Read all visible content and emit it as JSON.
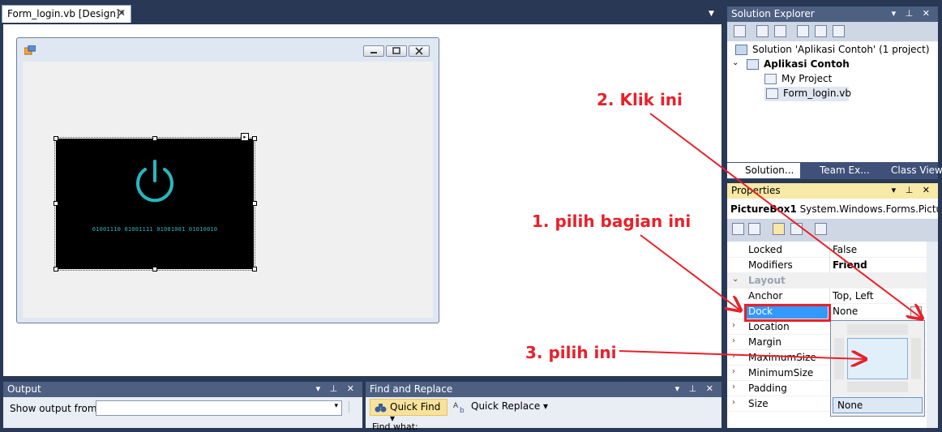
{
  "document": {
    "tab_title": "Form_login.vb [Design]*",
    "tab_close": "✕",
    "menu_arrow": "▼",
    "form": {
      "min_icon": "minimize-icon",
      "max_icon": "maximize-icon",
      "close_icon": "close-icon",
      "picturebox_text": "01001110 01001111 01001001 01010010",
      "smart_tag": "▸"
    }
  },
  "output": {
    "title": "Output",
    "controls": "▾ ⊥ ✕",
    "show_from_label": "Show output from:",
    "show_from_value": "",
    "dropdown_glyph": "▾"
  },
  "find_replace": {
    "title": "Find and Replace",
    "controls": "▾ ⊥ ✕",
    "quick_find": "Quick Find",
    "quick_replace": "Quick Replace",
    "dd_glyph": "▾",
    "find_what": "Find what:"
  },
  "solution_explorer": {
    "title": "Solution Explorer",
    "controls": "▾ ⊥ ✕",
    "tree": {
      "solution": "Solution 'Aplikasi Contoh' (1 project)",
      "project": "Aplikasi Contoh",
      "my_project": "My Project",
      "form_login": "Form_login.vb"
    },
    "tabs": [
      "Solution...",
      "Team Ex...",
      "Class View"
    ]
  },
  "properties": {
    "title": "Properties",
    "controls": "▾ ⊥ ✕",
    "object_name": "PictureBox1",
    "object_type": "System.Windows.Forms.Picture",
    "rows": {
      "locked": {
        "name": "Locked",
        "value": "False"
      },
      "modifiers": {
        "name": "Modifiers",
        "value": "Friend"
      },
      "layout": {
        "name": "Layout"
      },
      "anchor": {
        "name": "Anchor",
        "value": "Top, Left"
      },
      "dock": {
        "name": "Dock",
        "value": "None"
      },
      "location": {
        "name": "Location"
      },
      "margin": {
        "name": "Margin"
      },
      "maximumsize": {
        "name": "MaximumSize"
      },
      "minimumsize": {
        "name": "MinimumSize"
      },
      "padding": {
        "name": "Padding"
      },
      "size": {
        "name": "Size"
      }
    },
    "dock_editor_none": "None"
  },
  "annotations": {
    "step1": "1. pilih bagian ini",
    "step2": "2. Klik ini",
    "step3": "3. pilih ini"
  },
  "colors": {
    "annotation": "#e8202a",
    "active_title": "#f7e9a6",
    "ide_background": "#293955",
    "power_icon": "#27b8be"
  }
}
